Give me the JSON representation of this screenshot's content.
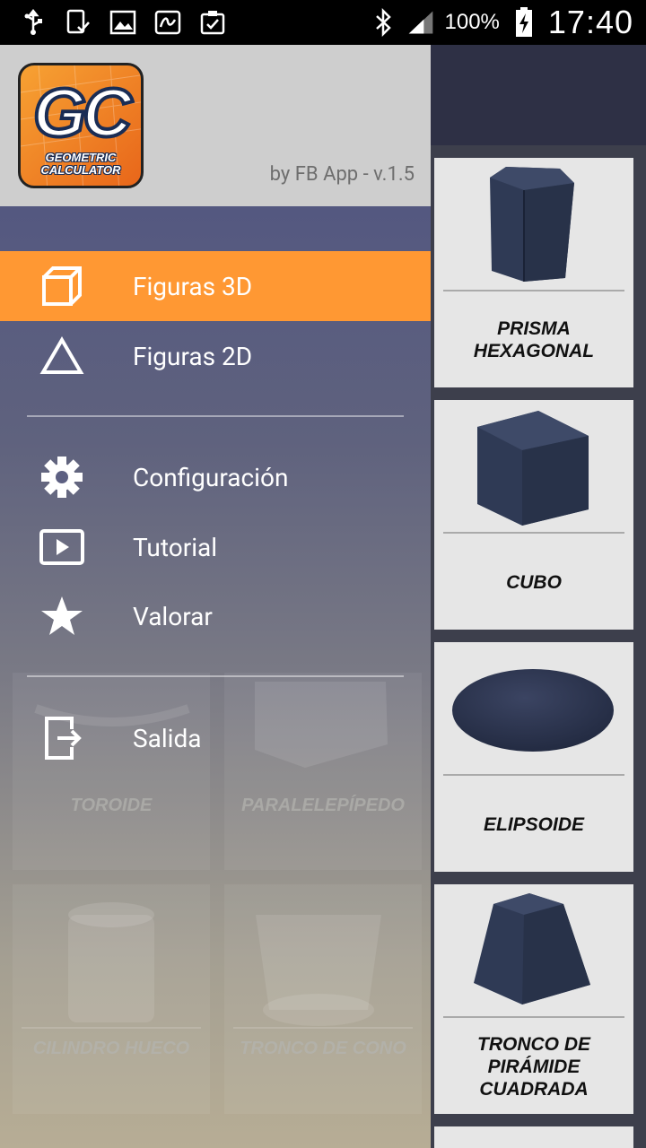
{
  "status_bar": {
    "battery_percent": "100%",
    "time": "17:40"
  },
  "drawer": {
    "logo_big": "GC",
    "logo_line1": "GEOMETRIC",
    "logo_line2": "CALCULATOR",
    "version_text": "by FB App - v.1.5",
    "items": [
      {
        "label": "Figuras 3D",
        "icon": "cube-icon",
        "active": true
      },
      {
        "label": "Figuras 2D",
        "icon": "triangle-icon",
        "active": false
      },
      {
        "label": "Configuración",
        "icon": "gear-icon",
        "active": false
      },
      {
        "label": "Tutorial",
        "icon": "play-icon",
        "active": false
      },
      {
        "label": "Valorar",
        "icon": "star-icon",
        "active": false
      },
      {
        "label": "Salida",
        "icon": "exit-icon",
        "active": false
      }
    ]
  },
  "cards_right": [
    {
      "name": "PRISMA HEXAGONAL"
    },
    {
      "name": "CUBO"
    },
    {
      "name": "ELIPSOIDE"
    },
    {
      "name": "TRONCO DE PIRÁMIDE CUADRADA"
    }
  ],
  "cards_under_drawer": [
    {
      "name": "TOROIDE"
    },
    {
      "name": "PARALELEPÍPEDO"
    },
    {
      "name": "CILINDRO HUECO"
    },
    {
      "name": "TRONCO DE CONO"
    }
  ],
  "colors": {
    "accent": "#ff9833",
    "drawer_top": "#545880",
    "shape_fill": "#2f3a55"
  }
}
